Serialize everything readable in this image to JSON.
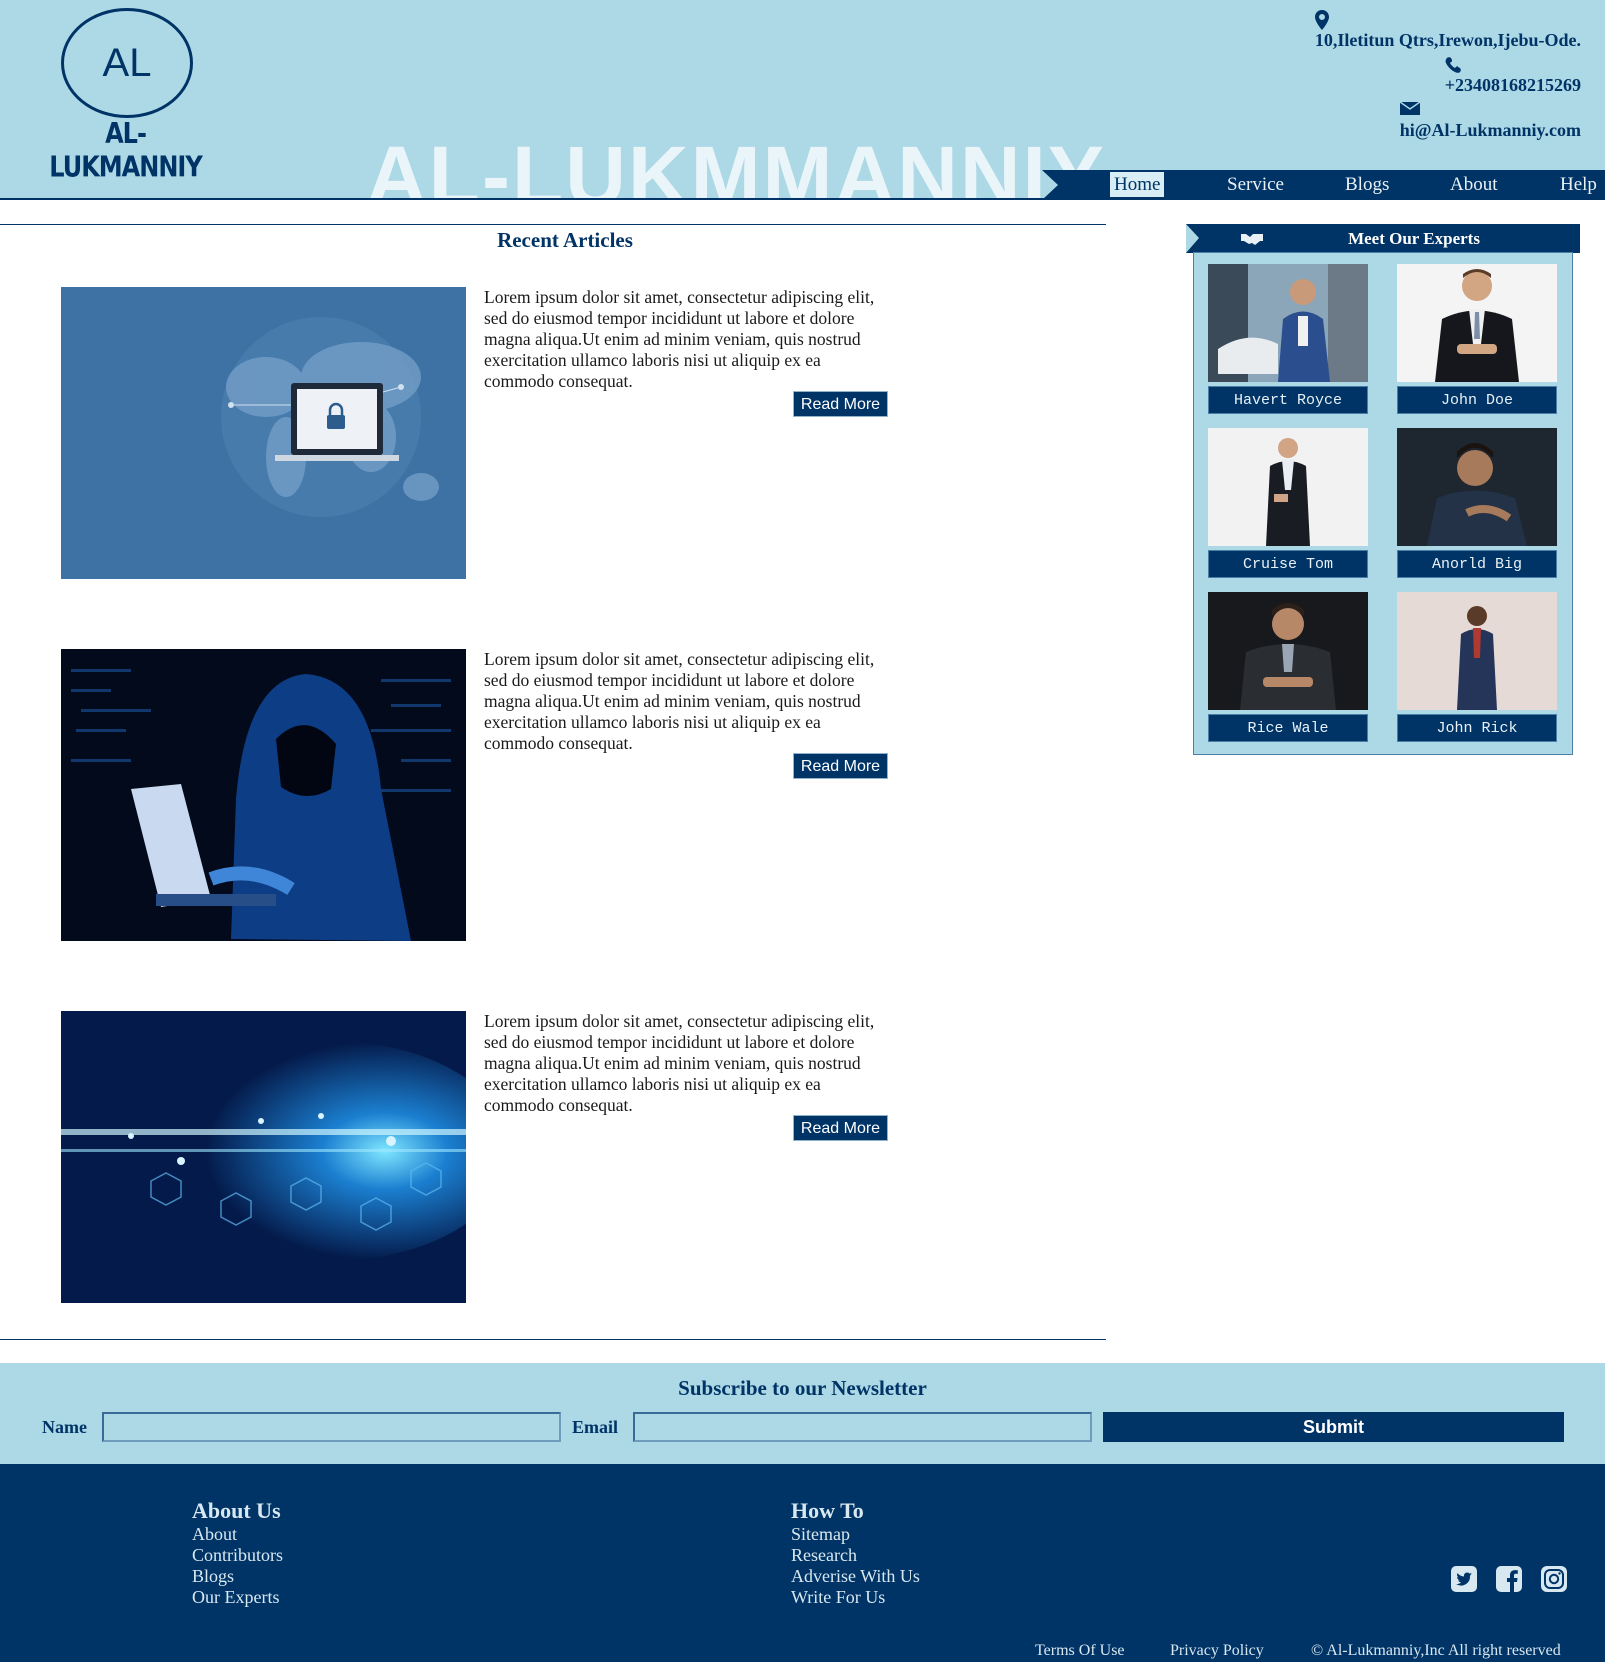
{
  "brand": {
    "logo_initials": "AL",
    "logo_wordmark": "AL-LUKMANNIY",
    "watermark": "AL-LUKMMANNIY"
  },
  "contact": {
    "address": "10,Ilетitun Qtrs,Irewon,Ijebu-Ode.",
    "phone": "+23408168215269",
    "email": "hi@Al-Lukmanniy.com",
    "icons": [
      "map-marker-icon",
      "phone-icon",
      "envelope-icon"
    ]
  },
  "nav": {
    "items": [
      {
        "label": "Home",
        "active": true
      },
      {
        "label": "Service",
        "active": false
      },
      {
        "label": "Blogs",
        "active": false
      },
      {
        "label": "About",
        "active": false
      },
      {
        "label": "Help",
        "active": false
      }
    ]
  },
  "articles": {
    "title": "Recent Articles",
    "items": [
      {
        "image": "world-map-laptop-lock",
        "text": "Lorem ipsum dolor sit amet, consectetur adipiscing elit, sed do eiusmod tempor incididunt ut labore et dolore magna aliqua.Ut enim ad minim veniam, quis nostrud exercitation ullamco laboris nisi ut aliquip ex ea commodo consequat.",
        "button": "Read More"
      },
      {
        "image": "hooded-hacker-laptop",
        "text": "Lorem ipsum dolor sit amet, consectetur adipiscing elit, sed do eiusmod tempor incididunt ut labore et dolore magna aliqua.Ut enim ad minim veniam, quis nostrud exercitation ullamco laboris nisi ut aliquip ex ea commodo consequat.",
        "button": "Read More"
      },
      {
        "image": "cybersecurity-network-glow",
        "text": "Lorem ipsum dolor sit amet, consectetur adipiscing elit, sed do eiusmod tempor incididunt ut labore et dolore magna aliqua.Ut enim ad minim veniam, quis nostrud exercitation ullamco laboris nisi ut aliquip ex ea commodo consequat.",
        "button": "Read More"
      }
    ]
  },
  "experts": {
    "title": "Meet Our Experts",
    "icon": "handshake-icon",
    "people": [
      {
        "name": "Havert Royce"
      },
      {
        "name": "John Doe"
      },
      {
        "name": "Cruise Tom"
      },
      {
        "name": "Anorld Big"
      },
      {
        "name": "Rice Wale"
      },
      {
        "name": "John Rick"
      }
    ]
  },
  "newsletter": {
    "title": "Subscribe to our Newsletter",
    "name_label": "Name",
    "name_value": "",
    "email_label": "Email",
    "email_value": "",
    "submit_label": "Submit"
  },
  "footer": {
    "about": {
      "heading": "About Us",
      "links": [
        "About",
        "Contributors",
        "Blogs",
        "Our Experts"
      ]
    },
    "howto": {
      "heading": "How To",
      "links": [
        "Sitemap",
        "Research",
        "Adverise With Us",
        "Write For Us"
      ]
    },
    "social": [
      "twitter-icon",
      "facebook-icon",
      "instagram-icon"
    ],
    "bottom": {
      "terms": "Terms Of Use",
      "privacy": "Privacy Policy",
      "copyright": "© Al-Lukmanniy,Inc All right reserved"
    }
  },
  "colors": {
    "primary": "#003366",
    "light": "#add8e6",
    "white": "#ffffff"
  }
}
